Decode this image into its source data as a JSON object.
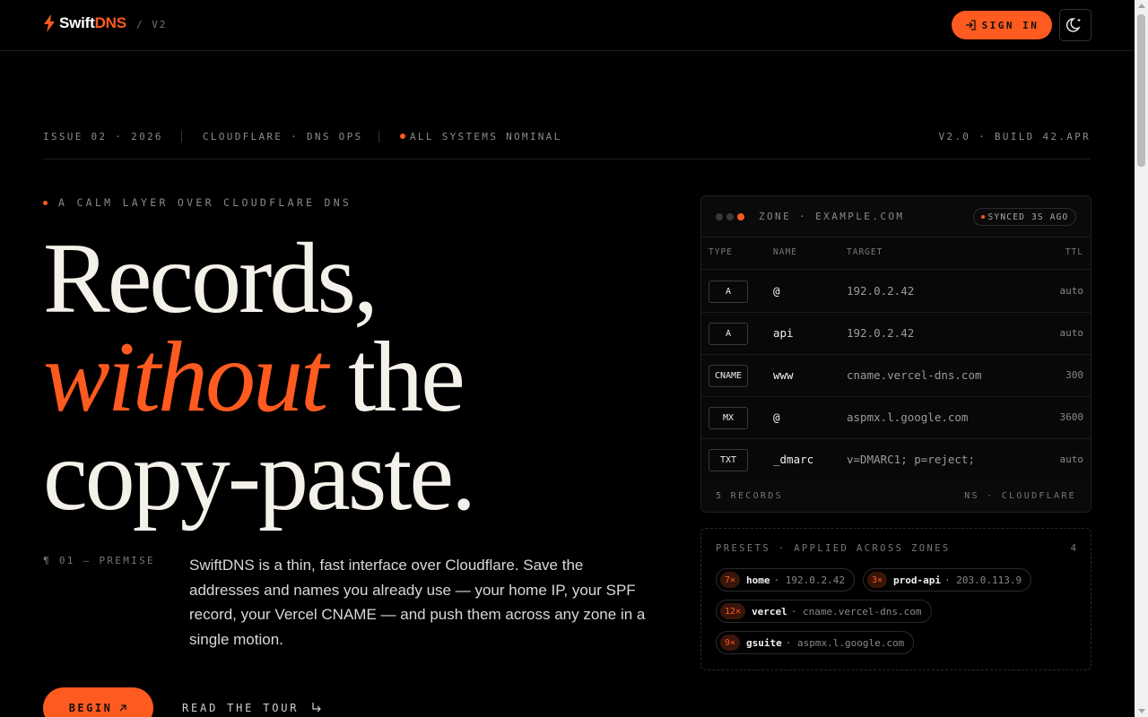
{
  "header": {
    "brand_prefix": "Swift",
    "brand_accent": "DNS",
    "version": "/ V2",
    "signin_label": "SIGN IN"
  },
  "meta": {
    "issue": "ISSUE 02 · 2026",
    "section": "CLOUDFLARE · DNS OPS",
    "status": "ALL SYSTEMS NOMINAL",
    "build": "V2.0 · BUILD 42.APR"
  },
  "hero": {
    "kicker": "A CALM LAYER OVER CLOUDFLARE DNS",
    "line1": "Records,",
    "line2_italic": "without",
    "line2_rest": "the",
    "line3": "copy-paste.",
    "premise_label": "¶ 01 — PREMISE",
    "premise_text": "SwiftDNS is a thin, fast interface over Cloudflare. Save the addresses and names you already use — your home IP, your SPF record, your Vercel CNAME — and push them across any zone in a single motion.",
    "begin_label": "BEGIN",
    "tour_label": "READ THE TOUR"
  },
  "zone": {
    "title": "ZONE · EXAMPLE.COM",
    "synced": "SYNCED 3S AGO",
    "columns": [
      "TYPE",
      "NAME",
      "TARGET",
      "TTL"
    ],
    "records": [
      {
        "type": "A",
        "name": "@",
        "target": "192.0.2.42",
        "ttl": "auto"
      },
      {
        "type": "A",
        "name": "api",
        "target": "192.0.2.42",
        "ttl": "auto"
      },
      {
        "type": "CNAME",
        "name": "www",
        "target": "cname.vercel-dns.com",
        "ttl": "300"
      },
      {
        "type": "MX",
        "name": "@",
        "target": "aspmx.l.google.com",
        "ttl": "3600"
      },
      {
        "type": "TXT",
        "name": "_dmarc",
        "target": "v=DMARC1; p=reject;",
        "ttl": "auto"
      }
    ],
    "footer_left": "5 RECORDS",
    "footer_right": "NS · CLOUDFLARE"
  },
  "presets": {
    "title": "PRESETS · APPLIED ACROSS ZONES",
    "count": "4",
    "items": [
      {
        "count": "7×",
        "name": "home",
        "value": "· 192.0.2.42"
      },
      {
        "count": "3×",
        "name": "prod-api",
        "value": "· 203.0.113.9"
      },
      {
        "count": "12×",
        "name": "vercel",
        "value": "· cname.vercel-dns.com"
      },
      {
        "count": "9×",
        "name": "gsuite",
        "value": "· aspmx.l.google.com"
      }
    ]
  },
  "icons": {
    "logo": "bolt-icon",
    "signin": "sign-in-icon",
    "theme": "moon-icon",
    "begin": "arrow-up-right-icon",
    "tour": "arrow-turn-down-right-icon"
  },
  "colors": {
    "accent": "#ff5a1f",
    "background": "#000000"
  }
}
